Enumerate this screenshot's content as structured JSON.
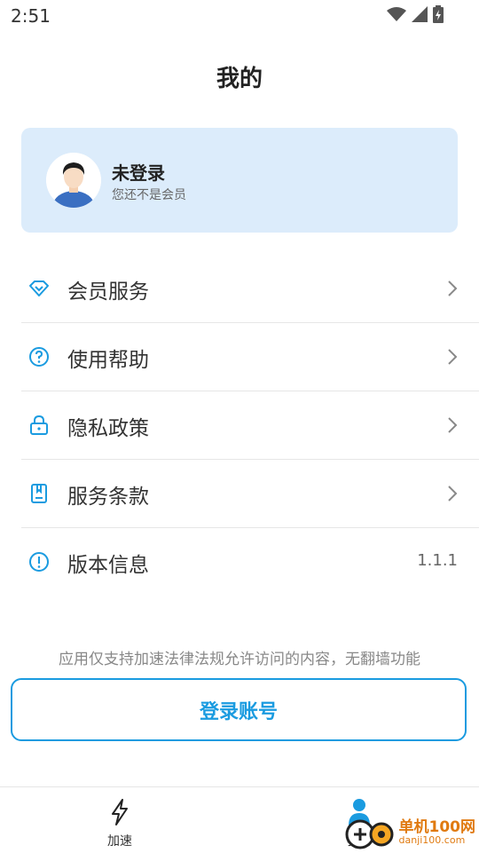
{
  "status": {
    "time": "2:51"
  },
  "header": {
    "title": "我的"
  },
  "profile": {
    "name": "未登录",
    "subtitle": "您还不是会员"
  },
  "menu": {
    "items": [
      {
        "label": "会员服务",
        "icon": "diamond-icon"
      },
      {
        "label": "使用帮助",
        "icon": "help-icon"
      },
      {
        "label": "隐私政策",
        "icon": "lock-icon"
      },
      {
        "label": "服务条款",
        "icon": "document-icon"
      },
      {
        "label": "版本信息",
        "icon": "info-icon",
        "value": "1.1.1"
      }
    ]
  },
  "notice": "应用仅支持加速法律法规允许访问的内容，无翻墙功能",
  "login_button": "登录账号",
  "bottom_nav": {
    "items": [
      {
        "label": "加速",
        "icon": "lightning-icon"
      },
      {
        "label": "我的",
        "icon": "person-icon"
      }
    ]
  },
  "watermark": {
    "main": "单机100网",
    "sub": "danji100.com"
  },
  "colors": {
    "accent": "#1a9be0",
    "card_bg": "#dcecfb",
    "watermark": "#e07a10"
  }
}
